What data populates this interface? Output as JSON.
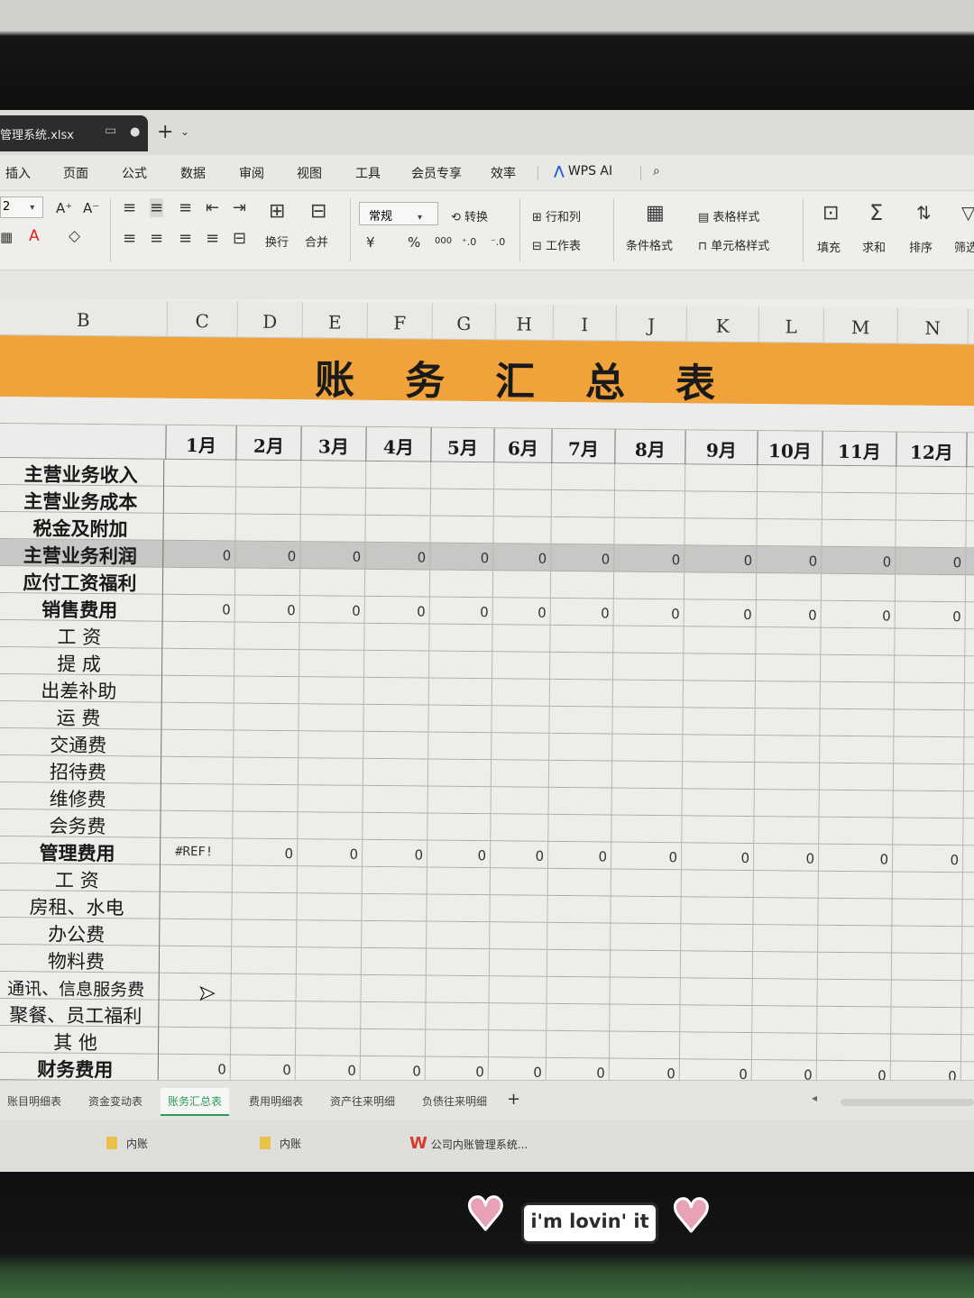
{
  "window": {
    "file_tab": "管理系统.xlsx",
    "tab_dot": "●",
    "monitor_glyph": "▭",
    "new_tab_glyph": "+"
  },
  "menu": {
    "items": [
      "插入",
      "页面",
      "公式",
      "数据",
      "审阅",
      "视图",
      "工具",
      "会员专享",
      "效率"
    ],
    "wps_ai": "WPS AI"
  },
  "ribbon": {
    "font_size": "2",
    "number_format": "常规",
    "labels": {
      "wrap": "换行",
      "merge": "合并",
      "convert": "转换",
      "rows_cols": "行和列",
      "worksheet": "工作表",
      "cond_format": "条件格式",
      "table_style": "表格样式",
      "cell_style": "单元格样式",
      "fill": "填充",
      "sum": "求和",
      "sort": "排序",
      "filter": "筛选"
    },
    "glyphs": {
      "font_grow": "A⁺",
      "font_shrink": "A⁻",
      "currency": "¥",
      "percent": "%",
      "thousands": "000",
      "dec_inc": "⁺.0",
      "dec_dec": "⁻.0"
    }
  },
  "sheet": {
    "columns": [
      "B",
      "C",
      "D",
      "E",
      "F",
      "G",
      "H",
      "I",
      "J",
      "K",
      "L",
      "M",
      "N"
    ],
    "title": "账务汇总表",
    "months": [
      "1月",
      "2月",
      "3月",
      "4月",
      "5月",
      "6月",
      "7月",
      "8月",
      "9月",
      "10月",
      "11月",
      "12月"
    ],
    "rows": [
      {
        "label": "主营业务收入",
        "bold": true,
        "values": []
      },
      {
        "label": "主营业务成本",
        "bold": true,
        "values": []
      },
      {
        "label": "税金及附加",
        "bold": true,
        "values": []
      },
      {
        "label": "主营业务利润",
        "bold": true,
        "shaded": true,
        "values": [
          "0",
          "0",
          "0",
          "0",
          "0",
          "0",
          "0",
          "0",
          "0",
          "0",
          "0",
          "0"
        ]
      },
      {
        "label": "应付工资福利",
        "bold": true,
        "values": []
      },
      {
        "label": "销售费用",
        "bold": true,
        "values": [
          "0",
          "0",
          "0",
          "0",
          "0",
          "0",
          "0",
          "0",
          "0",
          "0",
          "0",
          "0"
        ]
      },
      {
        "label": "工    资",
        "values": []
      },
      {
        "label": "提    成",
        "values": []
      },
      {
        "label": "出差补助",
        "values": []
      },
      {
        "label": "运    费",
        "values": []
      },
      {
        "label": "交通费",
        "values": []
      },
      {
        "label": "招待费",
        "values": []
      },
      {
        "label": "维修费",
        "values": []
      },
      {
        "label": "会务费",
        "values": []
      },
      {
        "label": "管理费用",
        "bold": true,
        "values": [
          "#REF!",
          "0",
          "0",
          "0",
          "0",
          "0",
          "0",
          "0",
          "0",
          "0",
          "0",
          "0"
        ]
      },
      {
        "label": "工    资",
        "values": []
      },
      {
        "label": "房租、水电",
        "values": []
      },
      {
        "label": "办公费",
        "values": []
      },
      {
        "label": "物料费",
        "values": []
      },
      {
        "label": "通讯、信息服务费",
        "small": true,
        "values": []
      },
      {
        "label": "聚餐、员工福利",
        "values": []
      },
      {
        "label": "其    他",
        "values": []
      },
      {
        "label": "财务费用",
        "bold": true,
        "values": [
          "0",
          "0",
          "0",
          "0",
          "0",
          "0",
          "0",
          "0",
          "0",
          "0",
          "0",
          "0"
        ]
      }
    ]
  },
  "sheet_tabs": {
    "items": [
      "账目明细表",
      "资金变动表",
      "账务汇总表",
      "费用明细表",
      "资产往来明细",
      "负债往来明细"
    ],
    "active": "账务汇总表",
    "add": "+"
  },
  "taskbar": {
    "items": [
      "内账",
      "内账",
      "公司内账管理系统..."
    ],
    "wps_glyph": "W"
  },
  "sticker": {
    "text": "i'm lovin' it",
    "heart": "♥"
  }
}
